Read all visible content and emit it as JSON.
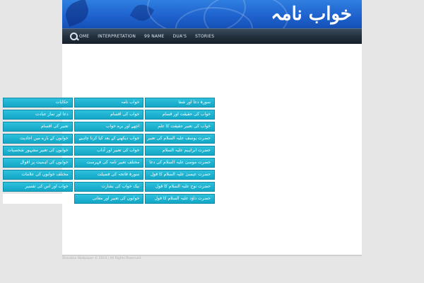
{
  "header": {
    "site_title": "خواب نامہ"
  },
  "nav": {
    "items": [
      {
        "label": "OME"
      },
      {
        "label": "INTERPRETATION"
      },
      {
        "label": "99 NAME"
      },
      {
        "label": "DUA'S"
      },
      {
        "label": "STORIES"
      }
    ]
  },
  "links": {
    "rows": [
      [
        "سورۃ دعا اور شفا",
        "خواب نامہ",
        "حکایات"
      ],
      [
        "خواب کی حقیقت اور قسام",
        "خواب کی اقسام",
        "دعا اور نماز عبادت"
      ],
      [
        "خواب کی تعبیر حقیقت کا علم",
        "اچھے اور برے خواب",
        "تعبیر کی اقسام"
      ],
      [
        "حضرت یوسف علیہ السلام کی تعبیر",
        "خواب دیکھنے کے بعد کیا کرنا چاہیے",
        "خوابوں کے بارے میں احادیث"
      ],
      [
        "حضرت ابراہیم علیہ السلام",
        "خواب کی تعبیر اور آداب",
        "خوابوں کی تعبیر مشہور شخصیات"
      ],
      [
        "حضرت موسیٰ علیہ السلام کی دعا",
        "مختلف تعبیر نامہ کی فہرست",
        "خوابوں کی اہمیت پر اقوال"
      ],
      [
        "حضرت عیسیٰ علیہ السلام کا قول",
        "سورۃ فاتحہ کی فضیلت",
        "مختلف خوابوں کی علامات"
      ],
      [
        "حضرت نوح علیہ السلام کا قول",
        "نیک خواب کی بشارت",
        "خواب اور اس کی تفسیر"
      ],
      [
        "حضرت داؤد علیہ السلام کا قول",
        "خوابوں کی تعبیر اور معانی",
        ""
      ]
    ]
  },
  "footer": {
    "text": "Sheraton Wallpaper © 2014 | All Rights Reserved"
  },
  "colors": {
    "banner": "#1f63cf",
    "nav": "#22303e",
    "cell": "#12a7c6",
    "page_bg": "#e6e6e6"
  }
}
